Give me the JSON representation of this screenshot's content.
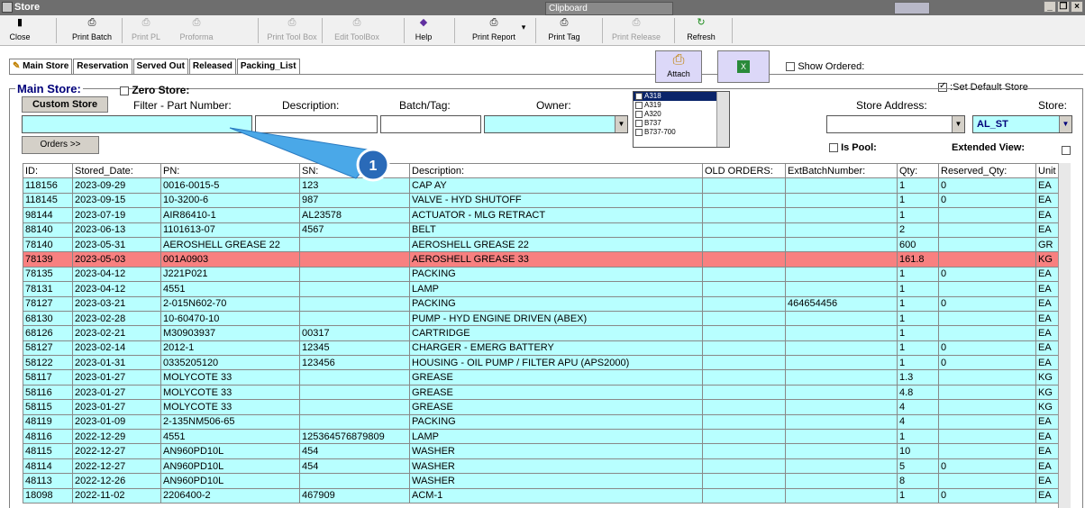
{
  "window": {
    "title": "Store",
    "clipboard_title": "Clipboard"
  },
  "toolbar": {
    "buttons": [
      {
        "label": "Close",
        "icon": "door-icon",
        "enabled": true
      },
      {
        "label": "Print Batch",
        "icon": "printer-icon",
        "enabled": true
      },
      {
        "label": "Print PL",
        "icon": "printer-icon",
        "enabled": false
      },
      {
        "label": "Proforma",
        "icon": "printer-icon",
        "enabled": false
      },
      {
        "label": "Print Tool Box",
        "icon": "printer-icon",
        "enabled": false
      },
      {
        "label": "Edit ToolBox",
        "icon": "printer-icon",
        "enabled": false
      },
      {
        "label": "Help",
        "icon": "help-icon",
        "enabled": true
      },
      {
        "label": "Print Report",
        "icon": "printer-icon",
        "enabled": true
      },
      {
        "label": "Print Tag",
        "icon": "printer-icon",
        "enabled": true
      },
      {
        "label": "Print Release",
        "icon": "printer-icon",
        "enabled": false
      },
      {
        "label": "Refresh",
        "icon": "refresh-icon",
        "enabled": true
      }
    ]
  },
  "tabs": [
    "Main Store",
    "Reservation",
    "Served Out",
    "Released",
    "Packing_List"
  ],
  "attach_label": "Attach",
  "show_ordered_label": "Show Ordered:",
  "set_default_store_label": ":Set Default Store",
  "main_store_label": "Main Store:",
  "zero_store_label": "Zero Store:",
  "custom_store_label": "Custom Store",
  "orders_label": "Orders >>",
  "filters": {
    "part_number": "Filter - Part Number:",
    "description": "Description:",
    "batch_tag": "Batch/Tag:",
    "owner": "Owner:",
    "store_address": "Store Address:",
    "store": "Store:",
    "store_value": "AL_ST"
  },
  "aircraft_list": [
    "A318",
    "A319",
    "A320",
    "B737",
    "B737-700"
  ],
  "is_pool_label": "Is Pool:",
  "extended_view_label": "Extended View:",
  "callout_number": "1",
  "table": {
    "headers": [
      "ID:",
      "Stored_Date:",
      "PN:",
      "SN:",
      "Description:",
      "OLD ORDERS:",
      "ExtBatchNumber:",
      "Qty:",
      "Reserved_Qty:",
      "Unit"
    ],
    "rows": [
      [
        "118156",
        "2023-09-29",
        "0016-0015-5",
        "123",
        "CAP AY",
        "",
        "",
        "1",
        "0",
        "EA"
      ],
      [
        "118145",
        "2023-09-15",
        "10-3200-6",
        "987",
        "VALVE - HYD SHUTOFF",
        "",
        "",
        "1",
        "0",
        "EA"
      ],
      [
        "98144",
        "2023-07-19",
        "AIR86410-1",
        "AL23578",
        "ACTUATOR - MLG RETRACT",
        "",
        "",
        "1",
        "",
        "EA"
      ],
      [
        "88140",
        "2023-06-13",
        "1101613-07",
        "4567",
        "BELT",
        "",
        "",
        "2",
        "",
        "EA"
      ],
      [
        "78140",
        "2023-05-31",
        "AEROSHELL GREASE 22",
        "",
        "AEROSHELL GREASE 22",
        "",
        "",
        "600",
        "",
        "GR"
      ],
      [
        "78139",
        "2023-05-03",
        "001A0903",
        "",
        "AEROSHELL GREASE 33",
        "",
        "",
        "161.8",
        "",
        "KG"
      ],
      [
        "78135",
        "2023-04-12",
        "J221P021",
        "",
        "PACKING",
        "",
        "",
        "1",
        "0",
        "EA"
      ],
      [
        "78131",
        "2023-04-12",
        "4551",
        "",
        "LAMP",
        "",
        "",
        "1",
        "",
        "EA"
      ],
      [
        "78127",
        "2023-03-21",
        "2-015N602-70",
        "",
        "PACKING",
        "",
        "464654456",
        "1",
        "0",
        "EA"
      ],
      [
        "68130",
        "2023-02-28",
        "10-60470-10",
        "",
        "PUMP - HYD ENGINE DRIVEN (ABEX)",
        "",
        "",
        "1",
        "",
        "EA"
      ],
      [
        "68126",
        "2023-02-21",
        "M30903937",
        "00317",
        "CARTRIDGE",
        "",
        "",
        "1",
        "",
        "EA"
      ],
      [
        "58127",
        "2023-02-14",
        "2012-1",
        "12345",
        "CHARGER - EMERG BATTERY",
        "",
        "",
        "1",
        "0",
        "EA"
      ],
      [
        "58122",
        "2023-01-31",
        "0335205120",
        "123456",
        "HOUSING - OIL PUMP / FILTER APU (APS2000)",
        "",
        "",
        "1",
        "0",
        "EA"
      ],
      [
        "58117",
        "2023-01-27",
        "MOLYCOTE 33",
        "",
        "GREASE",
        "",
        "",
        "1.3",
        "",
        "KG"
      ],
      [
        "58116",
        "2023-01-27",
        "MOLYCOTE 33",
        "",
        "GREASE",
        "",
        "",
        "4.8",
        "",
        "KG"
      ],
      [
        "58115",
        "2023-01-27",
        "MOLYCOTE 33",
        "",
        "GREASE",
        "",
        "",
        "4",
        "",
        "KG"
      ],
      [
        "48119",
        "2023-01-09",
        "2-135NM506-65",
        "",
        "PACKING",
        "",
        "",
        "4",
        "",
        "EA"
      ],
      [
        "48116",
        "2022-12-29",
        "4551",
        "125364576879809",
        "LAMP",
        "",
        "",
        "1",
        "",
        "EA"
      ],
      [
        "48115",
        "2022-12-27",
        "AN960PD10L",
        "454",
        "WASHER",
        "",
        "",
        "10",
        "",
        "EA"
      ],
      [
        "48114",
        "2022-12-27",
        "AN960PD10L",
        "454",
        "WASHER",
        "",
        "",
        "5",
        "0",
        "EA"
      ],
      [
        "48113",
        "2022-12-26",
        "AN960PD10L",
        "",
        "WASHER",
        "",
        "",
        "8",
        "",
        "EA"
      ],
      [
        "18098",
        "2022-11-02",
        "2206400-2",
        "467909",
        "ACM-1",
        "",
        "",
        "1",
        "0",
        "EA"
      ]
    ],
    "highlighted_row": 5
  }
}
